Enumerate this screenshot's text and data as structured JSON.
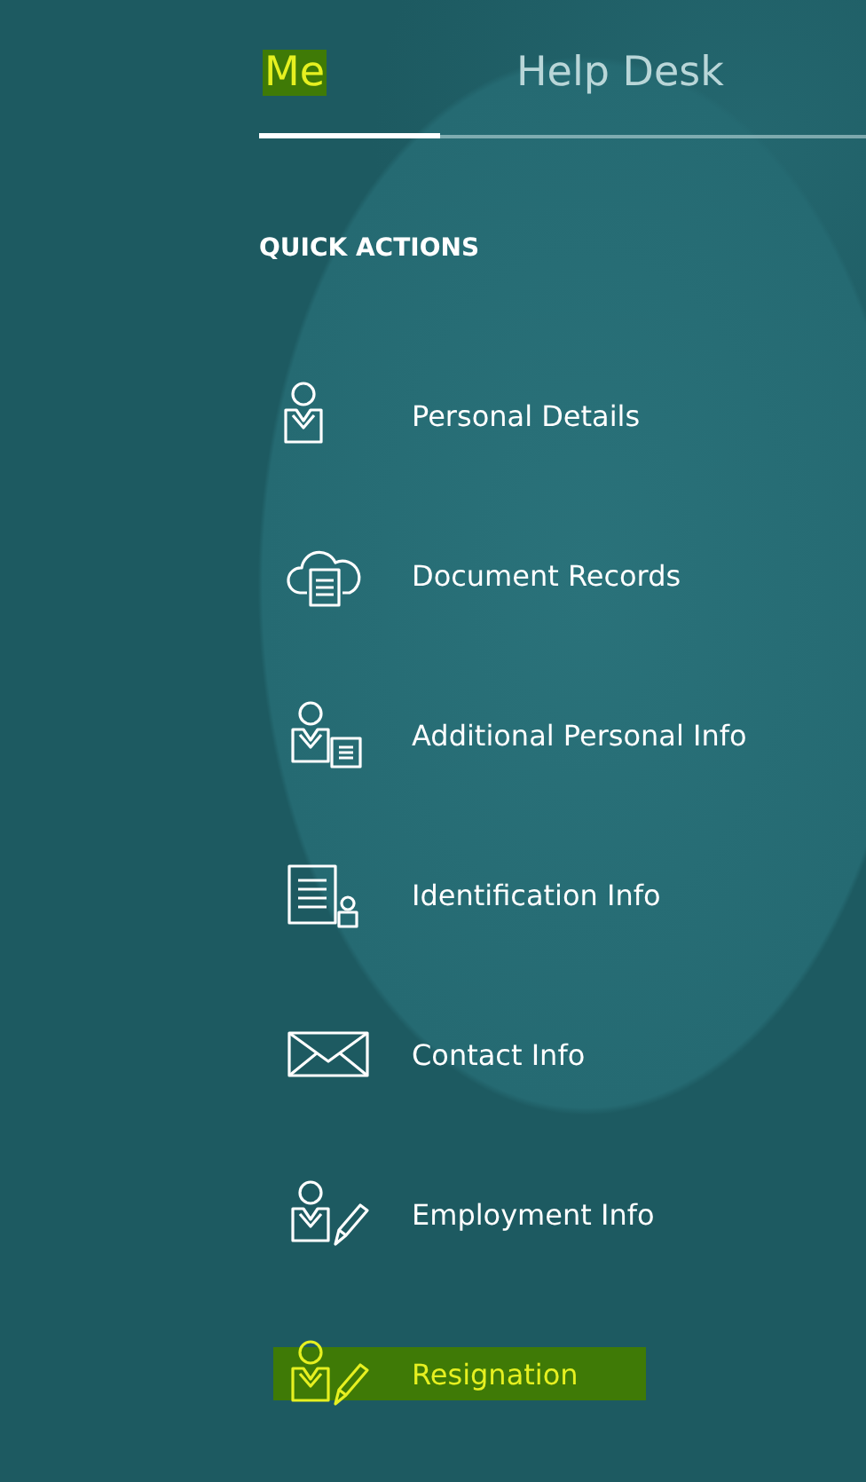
{
  "tabs": [
    {
      "label": "Me",
      "selected": true,
      "highlighted": true
    },
    {
      "label": "Help Desk",
      "selected": false,
      "highlighted": false
    }
  ],
  "quick_actions": {
    "title": "QUICK ACTIONS",
    "items": [
      {
        "label": "Personal Details",
        "highlighted": false
      },
      {
        "label": "Document Records",
        "highlighted": false
      },
      {
        "label": "Additional Personal Info",
        "highlighted": false
      },
      {
        "label": "Identification Info",
        "highlighted": false
      },
      {
        "label": "Contact Info",
        "highlighted": false
      },
      {
        "label": "Employment Info",
        "highlighted": false
      },
      {
        "label": "Resignation",
        "highlighted": true
      }
    ]
  }
}
